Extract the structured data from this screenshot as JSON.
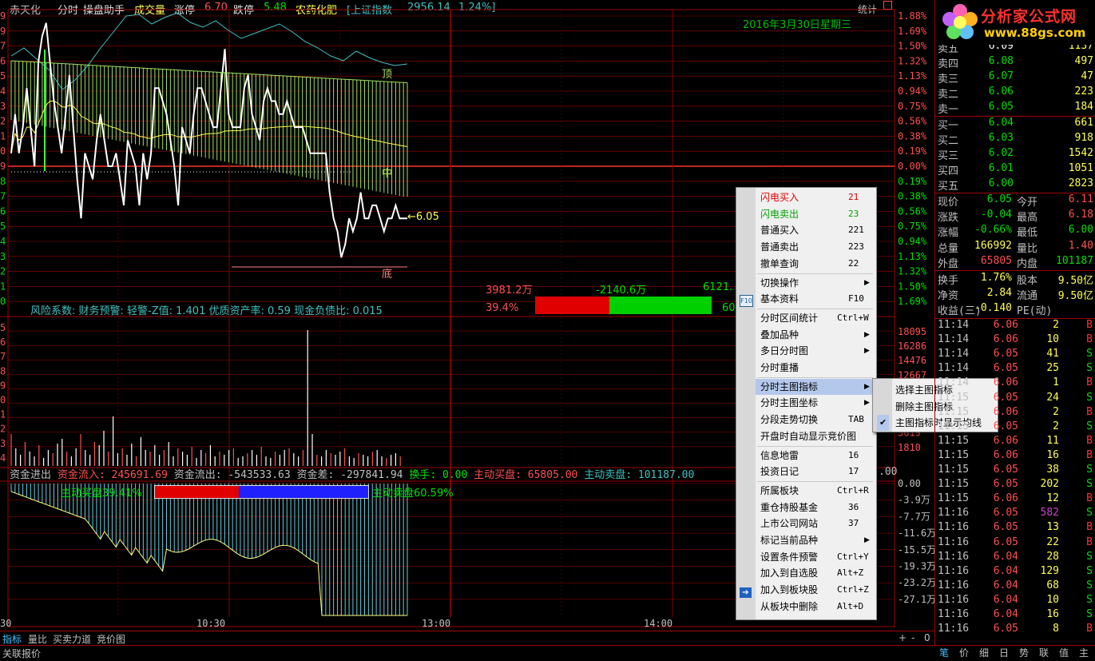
{
  "header": {
    "stock_name": "赤天化",
    "mode": "分时",
    "assistant": "操盘助手",
    "volume_label": "成交量",
    "limit_up_label": "涨停",
    "limit_up_value": "6.70",
    "limit_down_label": "跌停",
    "limit_down_value": "5.48",
    "sector": "农药化肥",
    "index_name": "[上证指数",
    "index_value": "2956.14",
    "index_change": "1.24%]",
    "stat_label": "统计"
  },
  "chart": {
    "date": "2016年3月30日星期三",
    "price_marker": "←6.05",
    "top_label": "顶",
    "mid_label": "中",
    "bottom_label": "底",
    "fin_info": "风险系数: 财务预警: 轻警-Z值: 1.401 优质资产率: 0.59 现金负债比: 0.015",
    "flow_in_amt": "3981.2万",
    "flow_diff_amt": "-2140.6万",
    "flow_out_amt": "6121.",
    "flow_in_pct": "39.4%",
    "flow_out_pct": "60",
    "pct_labels": [
      "1.88%",
      "1.69%",
      "1.50%",
      "1.32%",
      "1.13%",
      "0.94%",
      "0.75%",
      "0.56%",
      "0.38%",
      "0.19%",
      "0.00%",
      "0.19%",
      "0.38%",
      "0.56%",
      "0.75%",
      "0.94%",
      "1.13%",
      "1.32%",
      "1.50%",
      "1.69%"
    ],
    "left_labels": [
      "9",
      "9",
      "7",
      "6",
      "5",
      "4",
      "3",
      "2",
      "1",
      "0",
      "9",
      "8",
      "7",
      "6",
      "5",
      "4",
      "3",
      "2",
      "1",
      "0"
    ],
    "vol_labels": [
      "18095",
      "16286",
      "14476",
      "12667",
      "10857",
      "",
      "",
      "3619",
      "1810"
    ],
    "vol_left": [
      "5",
      "6",
      "7",
      "8",
      "9",
      "0",
      "1",
      "2",
      "3",
      "4"
    ],
    "money_labels": [
      "0.00",
      "-3.9万",
      "-7.7万",
      "-11.6万",
      "-15.5万",
      "-19.3万",
      "-23.2万",
      "-27.1万"
    ],
    "money_header": {
      "l1": "资金进出",
      "l2": "资金流入:",
      "v2": "245691.69",
      "l3": "资金流出:",
      "v3": "-543533.63",
      "l4": "资金差:",
      "v4": "-297841.94",
      "l5": "换手:",
      "v5": "0.00",
      "l6": "主动买盘:",
      "v6": "65805.00",
      "l7": "主动卖盘:",
      "v7": "101187.00",
      "tail": ".00"
    },
    "buy_ratio": "主动买盘39.41%",
    "sell_ratio": "主动卖盘60.59%",
    "buy_frac": 0.3941,
    "time_labels": [
      "30",
      "10:30",
      "13:00",
      "14:00"
    ]
  },
  "price_series": [
    6.1,
    6.13,
    6.1,
    6.12,
    6.15,
    6.12,
    6.09,
    6.17,
    6.19,
    6.2,
    6.17,
    6.14,
    6.12,
    6.1,
    6.13,
    6.16,
    6.12,
    6.08,
    6.05,
    6.1,
    6.09,
    6.08,
    6.11,
    6.13,
    6.11,
    6.09,
    6.09,
    6.1,
    6.08,
    6.06,
    6.11,
    6.1,
    6.09,
    6.06,
    6.1,
    6.08,
    6.1,
    6.15,
    6.15,
    6.14,
    6.13,
    6.11,
    6.09,
    6.06,
    6.12,
    6.11,
    6.1,
    6.13,
    6.15,
    6.15,
    6.14,
    6.13,
    6.12,
    6.12,
    6.15,
    6.18,
    6.13,
    6.12,
    6.12,
    6.12,
    6.15,
    6.16,
    6.13,
    6.12,
    6.11,
    6.14,
    6.15,
    6.14,
    6.14,
    6.13,
    6.13,
    6.14,
    6.13,
    6.12,
    6.12,
    6.12,
    6.11,
    6.1,
    6.1,
    6.1,
    6.1,
    6.1,
    6.07,
    6.05,
    6.04,
    6.02,
    6.03,
    6.05,
    6.04,
    6.05,
    6.07,
    6.05,
    6.05,
    6.06,
    6.06,
    6.05,
    6.04,
    6.05,
    6.05,
    6.06,
    6.05,
    6.05,
    6.05
  ],
  "context_menu": {
    "items": [
      {
        "label": "闪电买入",
        "shortcut": "21",
        "color": "#e00000"
      },
      {
        "label": "闪电卖出",
        "shortcut": "23",
        "color": "#00a000"
      },
      {
        "label": "普通买入",
        "shortcut": "221"
      },
      {
        "label": "普通卖出",
        "shortcut": "223"
      },
      {
        "label": "撤单查询",
        "shortcut": "22"
      },
      {
        "label": "切换操作",
        "shortcut": "",
        "sub": true,
        "sep": true
      },
      {
        "label": "基本资料",
        "shortcut": "F10"
      },
      {
        "label": "分时区间统计",
        "shortcut": "Ctrl+W",
        "sep": true
      },
      {
        "label": "叠加品种",
        "shortcut": "",
        "sub": true
      },
      {
        "label": "多日分时图",
        "shortcut": "",
        "sub": true
      },
      {
        "label": "分时重播",
        "shortcut": ""
      },
      {
        "label": "分时主图指标",
        "shortcut": "",
        "sub": true,
        "hl": true,
        "sep": true
      },
      {
        "label": "分时主图坐标",
        "shortcut": "",
        "sub": true
      },
      {
        "label": "分段走势切换",
        "shortcut": "TAB"
      },
      {
        "label": "开盘时自动显示竞价图",
        "shortcut": ""
      },
      {
        "label": "信息地雷",
        "shortcut": "16",
        "sep": true
      },
      {
        "label": "投资日记",
        "shortcut": "17"
      },
      {
        "label": "所属板块",
        "shortcut": "Ctrl+R",
        "sep": true
      },
      {
        "label": "重仓持股基金",
        "shortcut": "36"
      },
      {
        "label": "上市公司网站",
        "shortcut": "37"
      },
      {
        "label": "标记当前品种",
        "shortcut": "",
        "sub": true
      },
      {
        "label": "设置条件预警",
        "shortcut": "Ctrl+Y"
      },
      {
        "label": "加入到自选股",
        "shortcut": "Alt+Z"
      },
      {
        "label": "加入到板块股",
        "shortcut": "Ctrl+Z"
      },
      {
        "label": "从板块中删除",
        "shortcut": "Alt+D"
      }
    ],
    "f10_icon": "F10",
    "submenu": [
      {
        "label": "选择主图指标"
      },
      {
        "label": "删除主图指标"
      },
      {
        "label": "主图指标时显示均线",
        "checked": true
      }
    ]
  },
  "logo": {
    "brand": "分析家公式网",
    "url": "www.88gs.com"
  },
  "orderbook": {
    "asks": [
      {
        "label": "卖五",
        "price": "6.09",
        "vol": "1137"
      },
      {
        "label": "卖四",
        "price": "6.08",
        "vol": "497"
      },
      {
        "label": "卖三",
        "price": "6.07",
        "vol": "47"
      },
      {
        "label": "卖二",
        "price": "6.06",
        "vol": "223"
      },
      {
        "label": "卖一",
        "price": "6.05",
        "vol": "184"
      }
    ],
    "bids": [
      {
        "label": "买一",
        "price": "6.04",
        "vol": "661"
      },
      {
        "label": "买二",
        "price": "6.03",
        "vol": "918"
      },
      {
        "label": "买三",
        "price": "6.02",
        "vol": "1542"
      },
      {
        "label": "买四",
        "price": "6.01",
        "vol": "1051"
      },
      {
        "label": "买五",
        "price": "6.00",
        "vol": "2823"
      }
    ]
  },
  "quote": [
    {
      "k1": "现价",
      "v1": "6.05",
      "c1": "#00e000",
      "k2": "今开",
      "v2": "6.11",
      "c2": "#ff5050"
    },
    {
      "k1": "涨跌",
      "v1": "-0.04",
      "c1": "#00e000",
      "k2": "最高",
      "v2": "6.18",
      "c2": "#ff5050"
    },
    {
      "k1": "涨幅",
      "v1": "-0.66%",
      "c1": "#00e000",
      "k2": "最低",
      "v2": "6.00",
      "c2": "#00e000"
    },
    {
      "k1": "总量",
      "v1": "166992",
      "c1": "#ffff50",
      "k2": "量比",
      "v2": "1.40",
      "c2": "#ff5050"
    },
    {
      "k1": "外盘",
      "v1": "65805",
      "c1": "#ff5050",
      "k2": "内盘",
      "v2": "101187",
      "c2": "#00e000"
    },
    {
      "k1": "换手",
      "v1": "1.76%",
      "c1": "#ffff50",
      "k2": "股本",
      "v2": "9.50亿",
      "c2": "#ffff50"
    },
    {
      "k1": "净资",
      "v1": "2.84",
      "c1": "#ffff50",
      "k2": "流通",
      "v2": "9.50亿",
      "c2": "#ffff50"
    },
    {
      "k1": "收益(三)",
      "v1": "-0.140",
      "c1": "#ffff50",
      "k2": "PE(动)",
      "v2": "",
      "c2": "#ffff50"
    }
  ],
  "ticks": [
    {
      "t": "11:14",
      "p": "6.06",
      "v": "2",
      "s": "B"
    },
    {
      "t": "11:14",
      "p": "6.06",
      "v": "10",
      "s": "B"
    },
    {
      "t": "11:14",
      "p": "6.05",
      "v": "41",
      "s": "S"
    },
    {
      "t": "11:14",
      "p": "6.05",
      "v": "25",
      "s": "S"
    },
    {
      "t": "11:14",
      "p": "6.06",
      "v": "1",
      "s": "B"
    },
    {
      "t": "11:15",
      "p": "6.05",
      "v": "24",
      "s": "S"
    },
    {
      "t": "11:15",
      "p": "6.06",
      "v": "2",
      "s": "B"
    },
    {
      "t": "11:15",
      "p": "6.05",
      "v": "2",
      "s": "S"
    },
    {
      "t": "11:15",
      "p": "6.06",
      "v": "11",
      "s": "B"
    },
    {
      "t": "11:15",
      "p": "6.06",
      "v": "16",
      "s": "B"
    },
    {
      "t": "11:15",
      "p": "6.05",
      "v": "38",
      "s": "S"
    },
    {
      "t": "11:15",
      "p": "6.05",
      "v": "202",
      "s": "S"
    },
    {
      "t": "11:15",
      "p": "6.06",
      "v": "12",
      "s": "B"
    },
    {
      "t": "11:16",
      "p": "6.05",
      "v": "582",
      "s": "S",
      "vc": "#d040d0"
    },
    {
      "t": "11:16",
      "p": "6.05",
      "v": "13",
      "s": "B"
    },
    {
      "t": "11:16",
      "p": "6.05",
      "v": "22",
      "s": "B"
    },
    {
      "t": "11:16",
      "p": "6.04",
      "v": "28",
      "s": "S"
    },
    {
      "t": "11:16",
      "p": "6.04",
      "v": "129",
      "s": "S"
    },
    {
      "t": "11:16",
      "p": "6.04",
      "v": "68",
      "s": "S"
    },
    {
      "t": "11:16",
      "p": "6.04",
      "v": "10",
      "s": "S"
    },
    {
      "t": "11:16",
      "p": "6.04",
      "v": "16",
      "s": "S"
    },
    {
      "t": "11:16",
      "p": "6.05",
      "v": "8",
      "s": "B"
    }
  ],
  "bottom_tabs": [
    "指标",
    "量比",
    "买卖力道",
    "竞价图"
  ],
  "bottom_ctrl": [
    "+",
    "-",
    "0"
  ],
  "status_label": "关联报价",
  "right_tabs": [
    "笔",
    "价",
    "细",
    "日",
    "势",
    "联",
    "值",
    "主"
  ],
  "colors": {
    "grid": "#a00000",
    "up": "#ff5050",
    "down": "#00e000",
    "vol": "#ffff50",
    "cyan": "#40c0c0",
    "green_bar": "#a0e060"
  }
}
